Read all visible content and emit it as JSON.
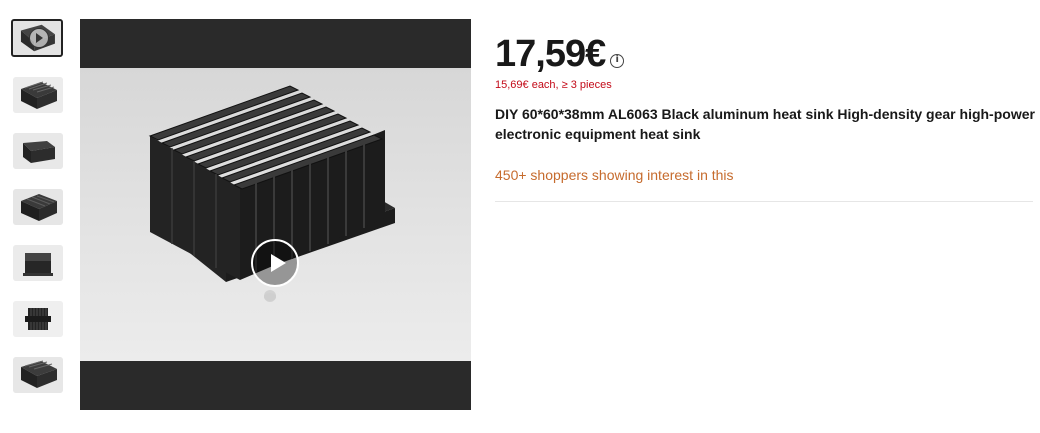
{
  "gallery": {
    "thumbnails": [
      {
        "kind": "video",
        "selected": true
      },
      {
        "kind": "image"
      },
      {
        "kind": "image"
      },
      {
        "kind": "image"
      },
      {
        "kind": "image"
      },
      {
        "kind": "image"
      },
      {
        "kind": "image"
      }
    ],
    "main": {
      "kind": "video",
      "play_icon": "play-icon"
    }
  },
  "product": {
    "price": "17,59€",
    "price_info_icon": "info-icon",
    "bulk_price": "15,69€ each, ≥ 3 pieces",
    "title": "DIY 60*60*38mm AL6063 Black aluminum heat sink High-density gear high-power electronic equipment heat sink",
    "interest": "450+ shoppers showing interest in this"
  },
  "colors": {
    "price_text": "#191919",
    "bulk_price_text": "#c30a18",
    "interest_text": "#c66b2d",
    "video_letterbox": "#2a2a2a"
  }
}
